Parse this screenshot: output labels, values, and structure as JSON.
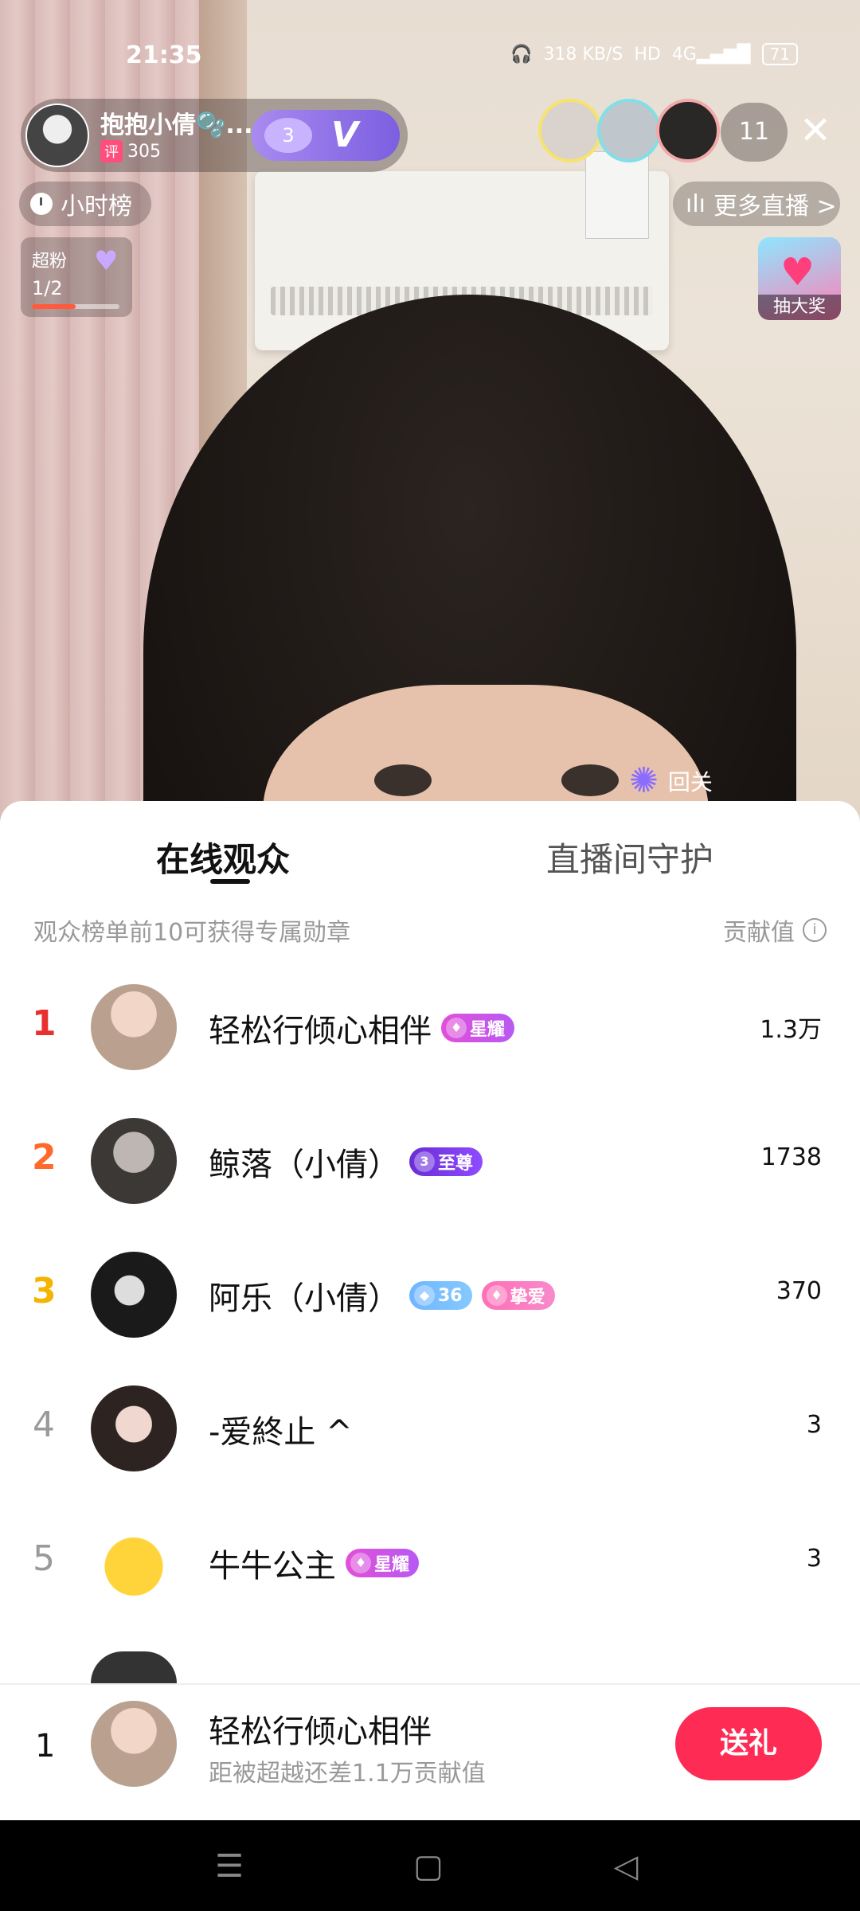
{
  "status_bar": {
    "time": "21:35",
    "speed": "318 KB/S",
    "hd": "HD",
    "network": "4G",
    "battery": "71"
  },
  "host": {
    "name": "抱抱小倩🫧...",
    "score_label": "评",
    "score": "305",
    "fan_level": "3",
    "vip": "V"
  },
  "top_viewers": {
    "count": "11"
  },
  "hourly_rank": {
    "label": "小时榜"
  },
  "more_live": {
    "label": "更多直播 >"
  },
  "superfan": {
    "title": "超粉",
    "progress_text": "1/2",
    "progress": 0.5
  },
  "lottery": {
    "label": "抽大奖"
  },
  "follow_hint": {
    "label": "回关"
  },
  "sheet": {
    "tabs": [
      {
        "label": "在线观众",
        "active": true
      },
      {
        "label": "直播间守护",
        "active": false
      }
    ],
    "hint": "观众榜单前10可获得专属勋章",
    "value_header": "贡献值",
    "rows": [
      {
        "rank": "1",
        "name": "轻松行倾心相伴",
        "badges": [
          {
            "text": "星耀"
          }
        ],
        "value": "1.3万"
      },
      {
        "rank": "2",
        "name": "鲸落（小倩）",
        "badges": [
          {
            "text": "至尊",
            "level": "3"
          }
        ],
        "value": "1738"
      },
      {
        "rank": "3",
        "name": "阿乐（小倩）",
        "badges": [
          {
            "text": "36"
          },
          {
            "text": "挚爱"
          }
        ],
        "value": "370"
      },
      {
        "rank": "4",
        "name": "-爱終止 ^",
        "badges": [],
        "value": "3"
      },
      {
        "rank": "5",
        "name": "牛牛公主",
        "badges": [
          {
            "text": "星耀"
          }
        ],
        "value": "3"
      }
    ]
  },
  "my_rank": {
    "rank": "1",
    "name": "轻松行倾心相伴",
    "subtitle": "距被超越还差1.1万贡献值",
    "gift_button": "送礼"
  },
  "colors": {
    "rank1": "#e8302f",
    "rank2": "#ff6a2c",
    "rank3": "#f5b400",
    "rank_other": "#9a9a9a",
    "gift_button": "#fe2c55"
  },
  "icons": [
    "headphones-icon",
    "signal-icon",
    "battery-icon",
    "clock-icon",
    "chart-icon",
    "close-icon",
    "info-icon",
    "heart-icon",
    "firework-icon"
  ]
}
